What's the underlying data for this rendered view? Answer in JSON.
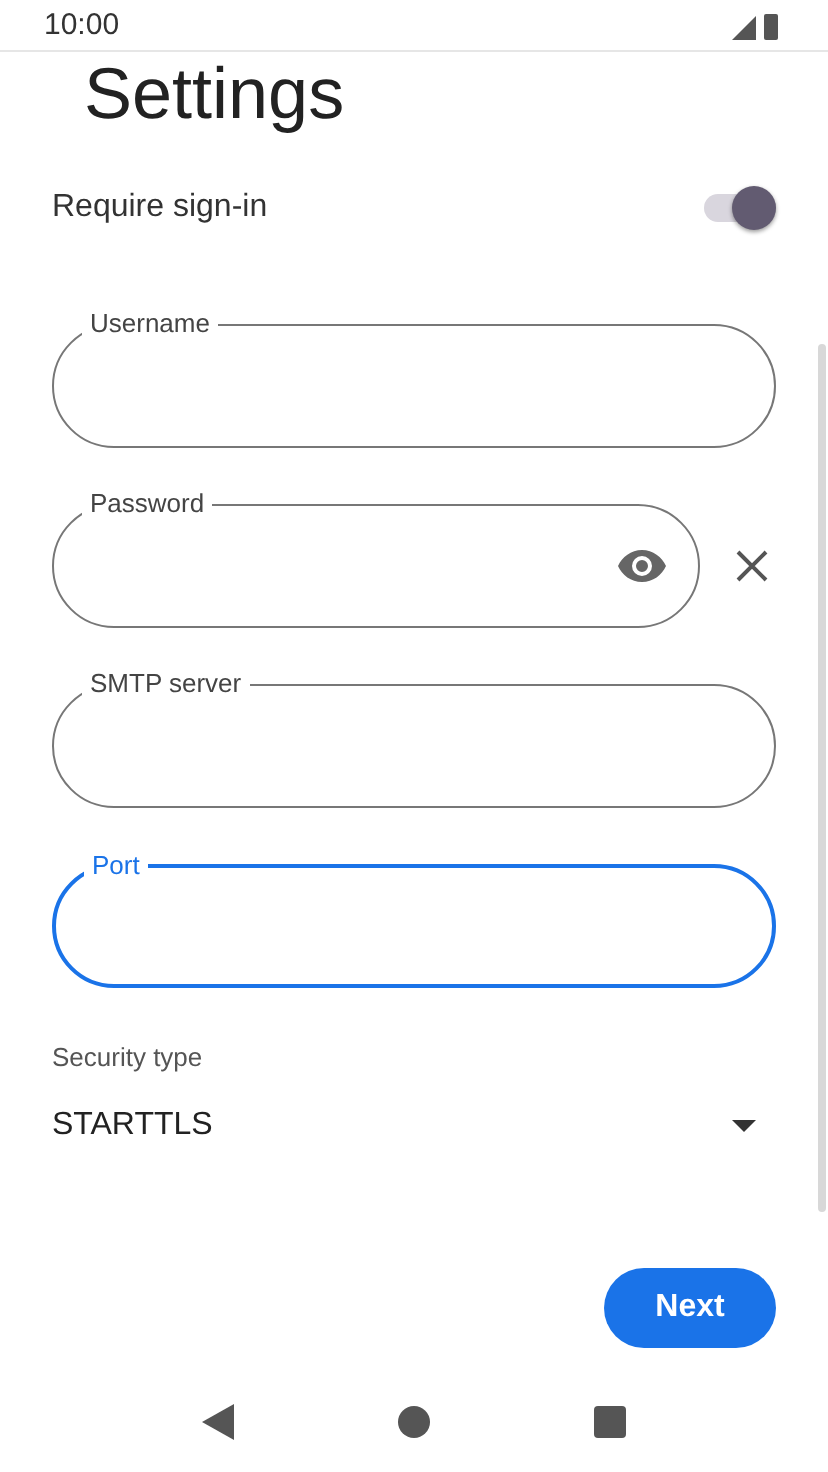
{
  "status_bar": {
    "time": "10:00"
  },
  "title": "Settings",
  "require_sign_in": {
    "label": "Require sign-in",
    "on": true
  },
  "fields": [
    {
      "label": "Username",
      "kind": "text",
      "focused": false
    },
    {
      "label": "Password",
      "kind": "password",
      "focused": false
    },
    {
      "label": "SMTP server",
      "kind": "text",
      "focused": false
    },
    {
      "label": "Port",
      "kind": "text",
      "focused": true
    }
  ],
  "security_type": {
    "label": "Security type",
    "value": "STARTTLS"
  },
  "next_button": "Next"
}
